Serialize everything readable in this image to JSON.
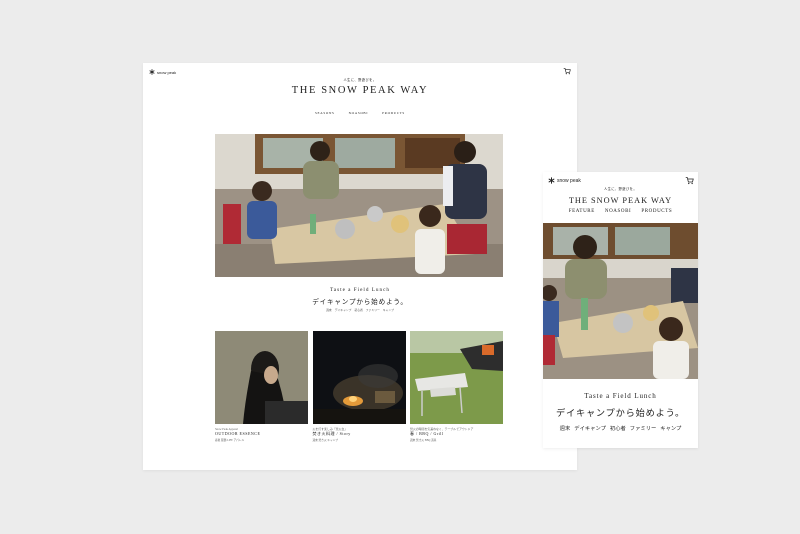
{
  "desktop": {
    "logo_text": "snow peak",
    "tagline": "人生に、野遊びを。",
    "title": "THE SNOW PEAK WAY",
    "nav": [
      "SEASONS",
      "NOASOBI",
      "PRODUCTS"
    ],
    "hero": {
      "subtitle": "Taste a Field Lunch",
      "title": "デイキャンプから始めよう。",
      "tags": [
        "週末",
        "デイキャンプ",
        "初心者",
        "ファミリー",
        "キャンプ"
      ]
    },
    "cards": [
      {
        "line1": "Snow Peak Apparel",
        "line2": "OUTDOOR ESSENCE",
        "tags": [
          "春夏",
          "服飾",
          "LIFE",
          "アパレル"
        ]
      },
      {
        "line1": "火を灯す楽しみ「焚火台」",
        "line2": "焚き火料理 / Story",
        "tags": [
          "週末",
          "焚き火",
          "キャンプ"
        ]
      },
      {
        "line1": "焚火の時間を気兼ねなく、テーブルでアウトドア",
        "line2": "春 / BBQ / Grill",
        "tags": [
          "週末",
          "焚き火",
          "BBQ",
          "道具"
        ]
      }
    ]
  },
  "mobile": {
    "logo_text": "snow peak",
    "tagline": "人生に、野遊びを。",
    "title": "THE SNOW PEAK WAY",
    "nav": [
      "FEATURE",
      "NOASOBI",
      "PRODUCTS"
    ],
    "hero": {
      "subtitle": "Taste a Field Lunch",
      "title": "デイキャンプから始めよう。",
      "tags": [
        "週末",
        "デイキャンプ",
        "初心者",
        "ファミリー",
        "キャンプ"
      ]
    }
  },
  "icons": {
    "logo": "snowflake-icon",
    "cart": "cart-icon"
  }
}
